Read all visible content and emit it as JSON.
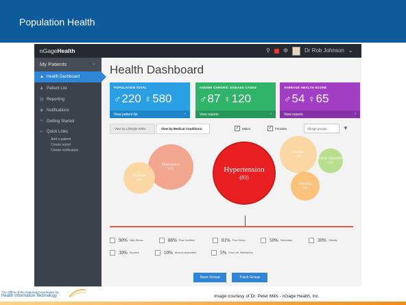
{
  "slide": {
    "title": "Population Health",
    "credit": "Image courtesy of Dr. Peter Mills - nGage Health, Inc.",
    "logo_line1": "The Office of the National Coordinator for",
    "logo_line2": "Health Information Technology"
  },
  "app": {
    "brand_prefix": "nGage",
    "brand_suffix": "Health",
    "user_name": "Dr Rob Johnson",
    "sidebar": {
      "header": "My Patients",
      "items": [
        {
          "label": "Health Dashboard",
          "icon": "activity-icon",
          "active": true
        },
        {
          "label": "Patient List",
          "icon": "people-icon"
        },
        {
          "label": "Reporting",
          "icon": "chart-icon"
        },
        {
          "label": "Notifications",
          "icon": "bell-icon"
        },
        {
          "label": "Getting Started",
          "icon": "wrench-icon"
        },
        {
          "label": "Quick Links",
          "icon": "link-icon"
        }
      ],
      "quick_links": [
        "Add a patient",
        "Create report",
        "Create notification"
      ]
    },
    "page_title": "Health Dashboard",
    "cards": [
      {
        "label": "POPULATION TOTAL",
        "male": "220",
        "female": "580",
        "footer": "View patient list",
        "color": "#2b9fe3"
      },
      {
        "label": "KNOWN CHRONIC DISEASE CASES",
        "male": "87",
        "female": "120",
        "footer": "View reports",
        "color": "#2fb46a"
      },
      {
        "label": "AVERAGE HEALTH SCORE",
        "male": "54",
        "female": "65",
        "footer": "View reports",
        "color": "#a13ec4"
      }
    ],
    "filters": {
      "tab_lifestyle": "View by Lifestyle Risks",
      "tab_medical": "View by Medical Conditions",
      "males": "Males",
      "females": "Females",
      "age_select": "All age groups"
    },
    "bubbles": [
      {
        "name": "Hypertension",
        "count": "(83)",
        "color": "#ea1f22"
      },
      {
        "name": "Depression",
        "count": "(63)",
        "color": "#f2a58f"
      },
      {
        "name": "Diabetes",
        "count": "(48)",
        "color": "#fbd7a4"
      },
      {
        "name": "Sleep Disorder",
        "count": "(30)",
        "color": "#b8df8e"
      },
      {
        "name": "Obesity",
        "count": "(40)",
        "color": "#fbc27c"
      },
      {
        "name": "Stroke",
        "count": "(18)",
        "color": "#fbd7a4"
      }
    ],
    "conditions": [
      {
        "pct": "90%",
        "name": "High Stress"
      },
      {
        "pct": "88%",
        "name": "Poor Nutrition"
      },
      {
        "pct": "81%",
        "name": "Poor Sleep"
      },
      {
        "pct": "50%",
        "name": "Sedentary"
      },
      {
        "pct": "30%",
        "name": "Obesity"
      },
      {
        "pct": "30%",
        "name": "Smokes"
      },
      {
        "pct": "10%",
        "name": "Alcohol dependent"
      },
      {
        "pct": "5%",
        "name": "Poor Life Satisfaction"
      }
    ],
    "buttons": {
      "save_group": "Save Group",
      "track_group": "Track Group"
    }
  }
}
